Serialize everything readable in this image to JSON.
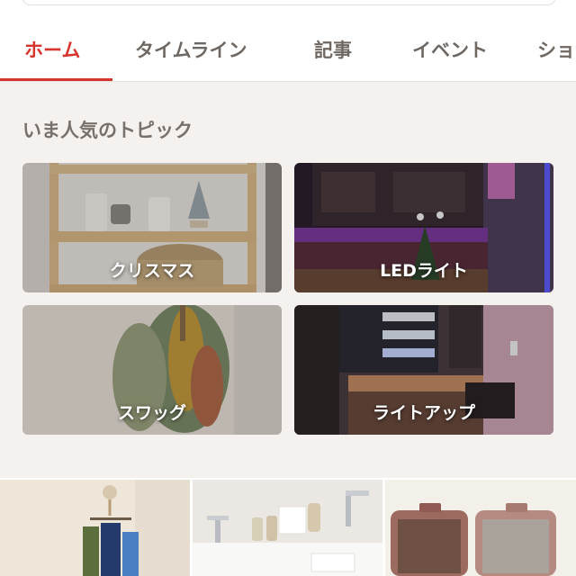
{
  "tabs": [
    {
      "label": "ホーム",
      "active": true
    },
    {
      "label": "タイムライン",
      "active": false
    },
    {
      "label": "記事",
      "active": false
    },
    {
      "label": "イベント",
      "active": false
    },
    {
      "label": "ショ",
      "active": false
    }
  ],
  "section": {
    "title": "いま人気のトピック",
    "topics": [
      {
        "label": "クリスマス"
      },
      {
        "label": "LEDライト"
      },
      {
        "label": "スワッグ"
      },
      {
        "label": "ライトアップ"
      }
    ]
  },
  "colors": {
    "accent": "#d6342c",
    "tab_text": "#6f6761",
    "section_bg": "#f4f1ef"
  }
}
